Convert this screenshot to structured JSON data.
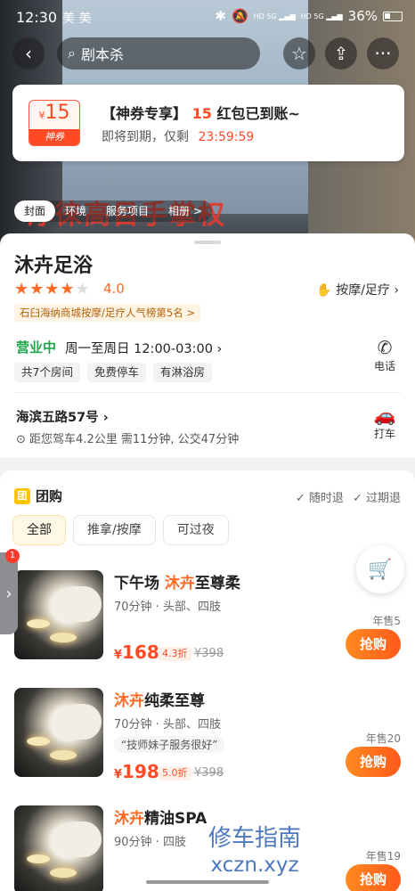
{
  "status": {
    "time": "12:30",
    "carrier": "美 美",
    "battery": "36%"
  },
  "nav": {
    "search_text": "剧本杀"
  },
  "coupon": {
    "amount": "15",
    "currency": "¥",
    "tag": "神券",
    "title_prefix": "【神券专享】",
    "title_num": "15",
    "title_suffix": "红包已到账~",
    "sub_text": "即将到期，仅剩",
    "countdown": "23:59:59"
  },
  "hero": {
    "overlay_text": "淳徕高目手掌权"
  },
  "media_tabs": [
    "封面",
    "环境",
    "服务项目",
    "相册 >"
  ],
  "shop": {
    "name": "沐卉足浴",
    "rating": "4.0",
    "category": "按摩/足疗",
    "rank": "石臼海纳商城按摩/足疗人气榜第5名 >",
    "open_status": "营业中",
    "hours": "周一至周日 12:00-03:00",
    "chips": [
      "共7个房间",
      "免费停车",
      "有淋浴房"
    ],
    "phone_label": "电话",
    "address": "海滨五路57号",
    "distance": "距您驾车4.2公里 需11分钟, 公交47分钟",
    "taxi_label": "打车"
  },
  "group": {
    "title": "团购",
    "tag": "团",
    "guarantees": [
      "随时退",
      "过期退"
    ],
    "filters": [
      "全部",
      "推拿/按摩",
      "可过夜"
    ],
    "deals": [
      {
        "name_pre": "下午场 ",
        "name_hl": "沐卉",
        "name_post": "至尊柔",
        "spec": "70分钟 · 头部、四肢",
        "quote": "",
        "price": "168",
        "discount": "4.3折",
        "orig": "¥398",
        "sold": "年售5",
        "buy": "抢购"
      },
      {
        "name_pre": "",
        "name_hl": "沐卉",
        "name_post": "纯柔至尊",
        "spec": "70分钟 · 头部、四肢",
        "quote": "“技师妹子服务很好”",
        "price": "198",
        "discount": "5.0折",
        "orig": "¥398",
        "sold": "年售20",
        "buy": "抢购"
      },
      {
        "name_pre": "",
        "name_hl": "沐卉",
        "name_post": "精油SPA",
        "spec": "90分钟 · 四肢",
        "quote": "",
        "price": "",
        "discount": "",
        "orig": "",
        "sold": "年售19",
        "buy": "抢购"
      }
    ]
  },
  "side_badge": "1",
  "site_watermark": {
    "cn": "修车指南",
    "url": "xczn.xyz"
  },
  "colors": {
    "accent": "#ff4a25",
    "open": "#20a84a",
    "star": "#ff6a25"
  }
}
